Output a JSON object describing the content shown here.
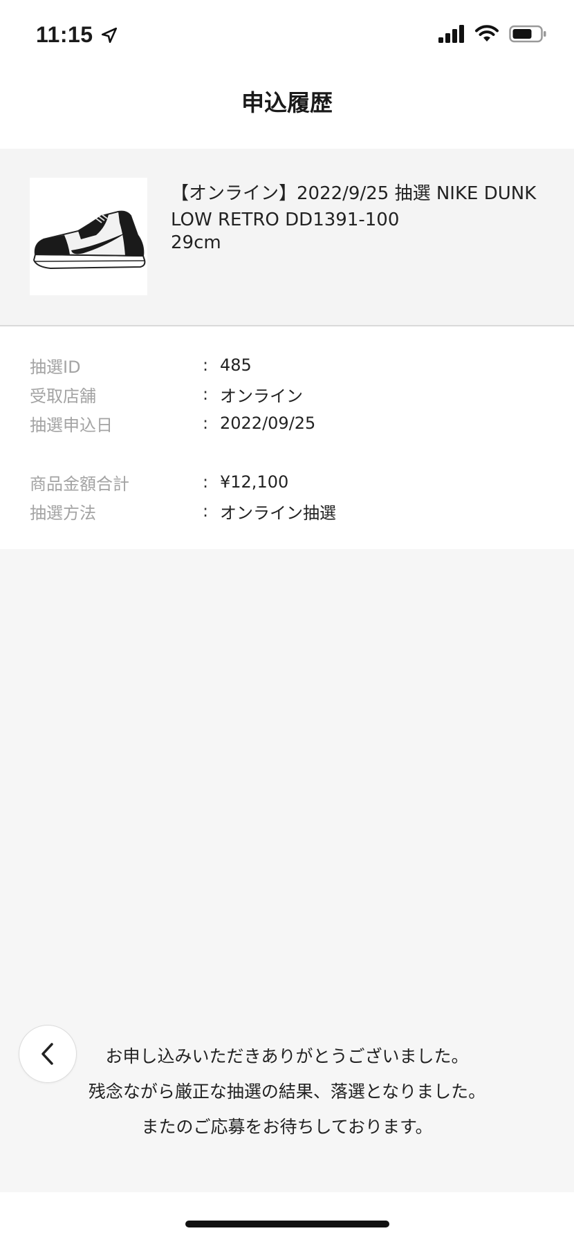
{
  "status_bar": {
    "time": "11:15"
  },
  "nav": {
    "title": "申込履歴"
  },
  "product": {
    "image_icon": "sneaker-image",
    "title_line1": "【オンライン】2022/9/25 抽選 NIKE DUNK",
    "title_line2": "LOW RETRO DD1391-100",
    "size": "29cm"
  },
  "details": {
    "separator": ":",
    "rows": [
      {
        "label": "抽選ID",
        "value": "485"
      },
      {
        "label": "受取店舗",
        "value": "オンライン"
      },
      {
        "label": "抽選申込日",
        "value": "2022/09/25"
      },
      {
        "label": "商品金額合計",
        "value": "¥12,100"
      },
      {
        "label": "抽選方法",
        "value": "オンライン抽選"
      }
    ]
  },
  "message": {
    "line1": "お申し込みいただきありがとうございました。",
    "line2": "残念ながら厳正な抽選の結果、落選となりました。",
    "line3": "またのご応募をお待ちしております。"
  },
  "colors": {
    "panel_bg": "#f4f4f4",
    "page_bg": "#f6f6f6",
    "label_gray": "#a3a3a3",
    "text": "#222222"
  }
}
